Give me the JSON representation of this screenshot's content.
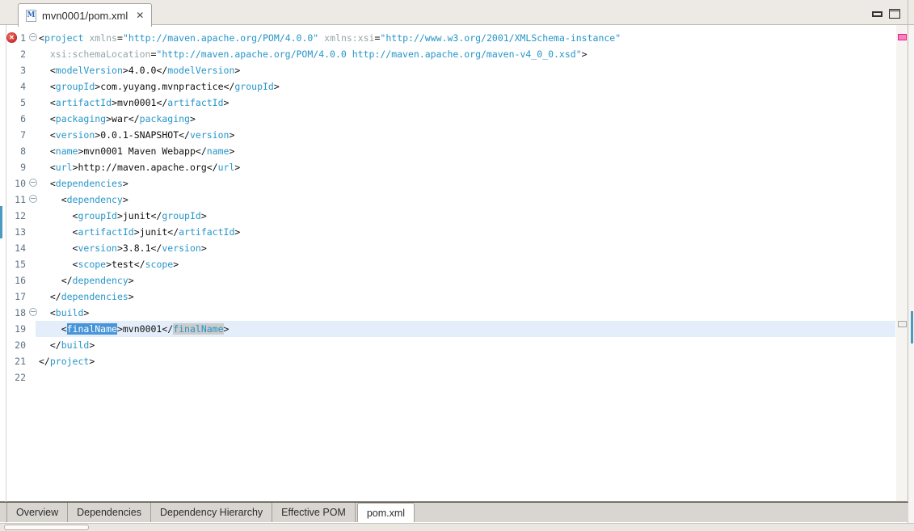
{
  "colors": {
    "tag_name": "#2795c8",
    "attr_name": "#96a5a8",
    "attr_value": "#2795c8",
    "selection_bg": "#4795d8",
    "occurrence_bg": "#cccccc",
    "current_line_bg": "#e4eefa",
    "range_indicator": "#4a9ac2",
    "error_red": "#bb1d1a",
    "marker_pink": "#fb7fc0"
  },
  "header": {
    "tab_title": "mvn0001/pom.xml",
    "close_glyph": "✕",
    "pom_icon_letter": "M"
  },
  "editor": {
    "error_glyph": "✕",
    "current_line": 19,
    "lines": [
      {
        "n": 1,
        "fold": true,
        "error": true,
        "segs": [
          [
            "b",
            "<"
          ],
          [
            "g",
            "project"
          ],
          [
            "b",
            " "
          ],
          [
            "a",
            "xmlns"
          ],
          [
            "b",
            "="
          ],
          [
            "v",
            "\"http://maven.apache.org/POM/4.0.0\""
          ],
          [
            "b",
            " "
          ],
          [
            "a",
            "xmlns:xsi"
          ],
          [
            "b",
            "="
          ],
          [
            "v",
            "\"http://www.w3.org/2001/XMLSchema-instance\""
          ]
        ]
      },
      {
        "n": 2,
        "segs": [
          [
            "b",
            "  "
          ],
          [
            "a",
            "xsi:schemaLocation"
          ],
          [
            "b",
            "="
          ],
          [
            "v",
            "\"http://maven.apache.org/POM/4.0.0 http://maven.apache.org/maven-v4_0_0.xsd\""
          ],
          [
            "b",
            ">"
          ]
        ]
      },
      {
        "n": 3,
        "segs": [
          [
            "b",
            "  <"
          ],
          [
            "g",
            "modelVersion"
          ],
          [
            "b",
            ">"
          ],
          [
            "x",
            "4.0.0"
          ],
          [
            "b",
            "</"
          ],
          [
            "g",
            "modelVersion"
          ],
          [
            "b",
            ">"
          ]
        ]
      },
      {
        "n": 4,
        "segs": [
          [
            "b",
            "  <"
          ],
          [
            "g",
            "groupId"
          ],
          [
            "b",
            ">"
          ],
          [
            "x",
            "com.yuyang.mvnpractice"
          ],
          [
            "b",
            "</"
          ],
          [
            "g",
            "groupId"
          ],
          [
            "b",
            ">"
          ]
        ]
      },
      {
        "n": 5,
        "segs": [
          [
            "b",
            "  <"
          ],
          [
            "g",
            "artifactId"
          ],
          [
            "b",
            ">"
          ],
          [
            "x",
            "mvn0001"
          ],
          [
            "b",
            "</"
          ],
          [
            "g",
            "artifactId"
          ],
          [
            "b",
            ">"
          ]
        ]
      },
      {
        "n": 6,
        "segs": [
          [
            "b",
            "  <"
          ],
          [
            "g",
            "packaging"
          ],
          [
            "b",
            ">"
          ],
          [
            "x",
            "war"
          ],
          [
            "b",
            "</"
          ],
          [
            "g",
            "packaging"
          ],
          [
            "b",
            ">"
          ]
        ]
      },
      {
        "n": 7,
        "segs": [
          [
            "b",
            "  <"
          ],
          [
            "g",
            "version"
          ],
          [
            "b",
            ">"
          ],
          [
            "x",
            "0.0.1-SNAPSHOT"
          ],
          [
            "b",
            "</"
          ],
          [
            "g",
            "version"
          ],
          [
            "b",
            ">"
          ]
        ]
      },
      {
        "n": 8,
        "segs": [
          [
            "b",
            "  <"
          ],
          [
            "g",
            "name"
          ],
          [
            "b",
            ">"
          ],
          [
            "x",
            "mvn0001 Maven Webapp"
          ],
          [
            "b",
            "</"
          ],
          [
            "g",
            "name"
          ],
          [
            "b",
            ">"
          ]
        ]
      },
      {
        "n": 9,
        "segs": [
          [
            "b",
            "  <"
          ],
          [
            "g",
            "url"
          ],
          [
            "b",
            ">"
          ],
          [
            "x",
            "http://maven.apache.org"
          ],
          [
            "b",
            "</"
          ],
          [
            "g",
            "url"
          ],
          [
            "b",
            ">"
          ]
        ]
      },
      {
        "n": 10,
        "fold": true,
        "segs": [
          [
            "b",
            "  <"
          ],
          [
            "g",
            "dependencies"
          ],
          [
            "b",
            ">"
          ]
        ]
      },
      {
        "n": 11,
        "fold": true,
        "segs": [
          [
            "b",
            "    <"
          ],
          [
            "g",
            "dependency"
          ],
          [
            "b",
            ">"
          ]
        ]
      },
      {
        "n": 12,
        "segs": [
          [
            "b",
            "      <"
          ],
          [
            "g",
            "groupId"
          ],
          [
            "b",
            ">"
          ],
          [
            "x",
            "junit"
          ],
          [
            "b",
            "</"
          ],
          [
            "g",
            "groupId"
          ],
          [
            "b",
            ">"
          ]
        ]
      },
      {
        "n": 13,
        "segs": [
          [
            "b",
            "      <"
          ],
          [
            "g",
            "artifactId"
          ],
          [
            "b",
            ">"
          ],
          [
            "x",
            "junit"
          ],
          [
            "b",
            "</"
          ],
          [
            "g",
            "artifactId"
          ],
          [
            "b",
            ">"
          ]
        ]
      },
      {
        "n": 14,
        "segs": [
          [
            "b",
            "      <"
          ],
          [
            "g",
            "version"
          ],
          [
            "b",
            ">"
          ],
          [
            "x",
            "3.8.1"
          ],
          [
            "b",
            "</"
          ],
          [
            "g",
            "version"
          ],
          [
            "b",
            ">"
          ]
        ]
      },
      {
        "n": 15,
        "segs": [
          [
            "b",
            "      <"
          ],
          [
            "g",
            "scope"
          ],
          [
            "b",
            ">"
          ],
          [
            "x",
            "test"
          ],
          [
            "b",
            "</"
          ],
          [
            "g",
            "scope"
          ],
          [
            "b",
            ">"
          ]
        ]
      },
      {
        "n": 16,
        "segs": [
          [
            "b",
            "    </"
          ],
          [
            "g",
            "dependency"
          ],
          [
            "b",
            ">"
          ]
        ]
      },
      {
        "n": 17,
        "segs": [
          [
            "b",
            "  </"
          ],
          [
            "g",
            "dependencies"
          ],
          [
            "b",
            ">"
          ]
        ]
      },
      {
        "n": 18,
        "fold": true,
        "segs": [
          [
            "b",
            "  <"
          ],
          [
            "g",
            "build"
          ],
          [
            "b",
            ">"
          ]
        ]
      },
      {
        "n": 19,
        "current": true,
        "segs": [
          [
            "b",
            "    <"
          ],
          [
            "s",
            "finalName"
          ],
          [
            "b",
            ">"
          ],
          [
            "x",
            "mvn0001"
          ],
          [
            "b",
            "</"
          ],
          [
            "o",
            "finalName"
          ],
          [
            "b",
            ">"
          ]
        ]
      },
      {
        "n": 20,
        "segs": [
          [
            "b",
            "  </"
          ],
          [
            "g",
            "build"
          ],
          [
            "b",
            ">"
          ]
        ]
      },
      {
        "n": 21,
        "segs": [
          [
            "b",
            "</"
          ],
          [
            "g",
            "project"
          ],
          [
            "b",
            ">"
          ]
        ]
      },
      {
        "n": 22,
        "segs": []
      }
    ]
  },
  "bottom_tabs": {
    "items": [
      {
        "label": "Overview",
        "active": false
      },
      {
        "label": "Dependencies",
        "active": false
      },
      {
        "label": "Dependency Hierarchy",
        "active": false
      },
      {
        "label": "Effective POM",
        "active": false
      },
      {
        "label": "pom.xml",
        "active": true
      }
    ]
  }
}
